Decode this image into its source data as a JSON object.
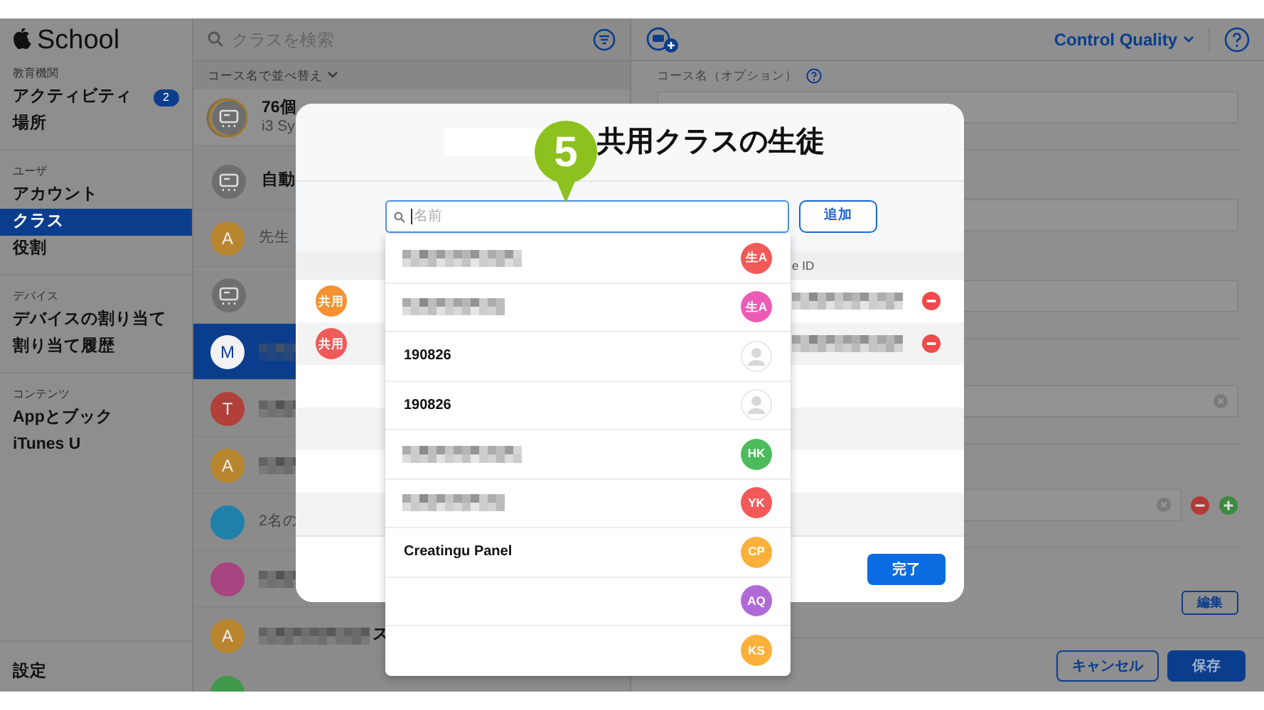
{
  "sidebar": {
    "logo": "School",
    "sections": [
      {
        "title": "教育機関",
        "items": [
          {
            "label": "アクティビティ",
            "badge": "2",
            "selected": false
          },
          {
            "label": "場所",
            "selected": false
          }
        ]
      },
      {
        "title": "ユーザ",
        "items": [
          {
            "label": "アカウント",
            "selected": false
          },
          {
            "label": "クラス",
            "selected": true
          },
          {
            "label": "役割",
            "selected": false
          }
        ]
      },
      {
        "title": "デバイス",
        "items": [
          {
            "label": "デバイスの割り当て",
            "selected": false
          },
          {
            "label": "割り当て履歴",
            "selected": false
          }
        ]
      },
      {
        "title": "コンテンツ",
        "items": [
          {
            "label": "Appとブック",
            "selected": false
          },
          {
            "label": "iTunes U",
            "selected": false
          }
        ]
      }
    ],
    "footer_item": "設定"
  },
  "class_list": {
    "search_placeholder": "クラスを検索",
    "sort_label": "コース名で並べ替え",
    "rows": [
      {
        "kind": "group",
        "stacked": true,
        "title": "76個",
        "subtitle": "i3 Sy",
        "selected": false
      },
      {
        "kind": "group",
        "title": "自動",
        "selected": false
      },
      {
        "kind": "letter",
        "letter": "A",
        "color": "#b8862f",
        "subtitle": "先生",
        "selected": false
      },
      {
        "kind": "group",
        "selected": false
      },
      {
        "kind": "letter",
        "letter": "M",
        "color": "#0d3f8f",
        "redacted": true,
        "selected": true
      },
      {
        "kind": "letter",
        "letter": "T",
        "color": "#b23f3a",
        "redacted": true,
        "selected": false
      },
      {
        "kind": "letter",
        "letter": "A",
        "color": "#b8862f",
        "redacted": true,
        "selected": false
      },
      {
        "kind": "blank",
        "color": "#1f80aa",
        "subtitle": "2名の",
        "selected": false
      },
      {
        "kind": "blank",
        "color": "#a8447f",
        "redacted": true,
        "selected": false
      },
      {
        "kind": "letter",
        "letter": "A",
        "color": "#b8862f",
        "redacted": true,
        "title": "ス",
        "selected": false
      },
      {
        "kind": "blank",
        "color": "#3f9a4c",
        "selected": false
      }
    ]
  },
  "detail": {
    "account_menu": "Control Quality",
    "field_label": "コース名（オプション）",
    "fields": [
      {
        "kind": "plain"
      },
      {
        "kind": "plain"
      },
      {
        "kind": "plain"
      },
      {
        "kind": "clearable"
      },
      {
        "kind": "removable"
      }
    ],
    "edit_button": "編集",
    "cancel_button": "キャンセル",
    "save_button": "保存"
  },
  "dialog": {
    "title": "共用クラスの生徒",
    "search": {
      "placeholder": "名前"
    },
    "add_button": "追加",
    "column_header": "e ID",
    "members": [
      {
        "badge": "共用",
        "color": "#f7902f"
      },
      {
        "badge": "共用",
        "color": "#f25a5a"
      }
    ],
    "done_button": "完了",
    "suggestions": [
      {
        "kind": "redacted",
        "initials": "生A",
        "color": "#f25a5a"
      },
      {
        "kind": "redacted",
        "initials": "生A",
        "color": "#ec5cb6"
      },
      {
        "kind": "name",
        "name": "190826"
      },
      {
        "kind": "name",
        "name": "190826"
      },
      {
        "kind": "redacted",
        "initials": "HK",
        "color": "#4cbb5b"
      },
      {
        "kind": "redacted",
        "initials": "YK",
        "color": "#f25a5a"
      },
      {
        "kind": "name",
        "name": "Creatingu Panel",
        "initials": "CP",
        "color": "#fbb03b"
      },
      {
        "kind": "blank",
        "initials": "AQ",
        "color": "#b06ad8"
      },
      {
        "kind": "blank",
        "initials": "KS",
        "color": "#fbb03b"
      }
    ]
  },
  "callout": "5"
}
